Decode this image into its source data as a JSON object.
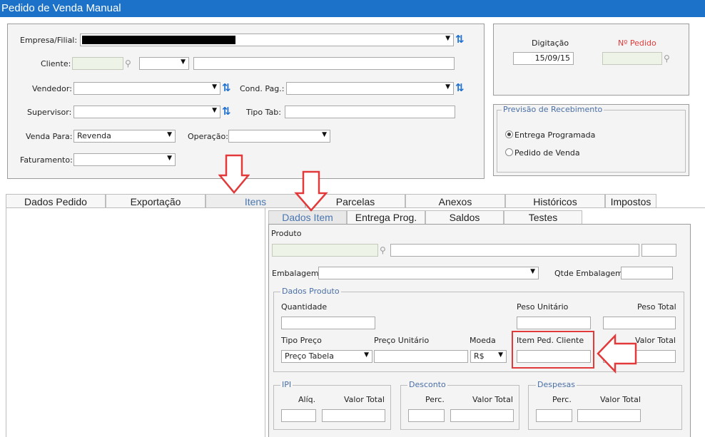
{
  "title": "Pedido de Venda Manual",
  "header": {
    "empresa_label": "Empresa/Filial:",
    "cliente_label": "Cliente:",
    "vendedor_label": "Vendedor:",
    "cond_pag_label": "Cond. Pag.:",
    "supervisor_label": "Supervisor:",
    "tipo_tab_label": "Tipo Tab:",
    "venda_para_label": "Venda Para:",
    "venda_para_value": "Revenda",
    "operacao_label": "Operação:",
    "faturamento_label": "Faturamento:"
  },
  "right_panel": {
    "digitacao_label": "Digitação",
    "digitacao_value": "15/09/15",
    "pedido_label": "Nº Pedido",
    "pedido_color": "#e23a3a"
  },
  "previsao": {
    "legend": "Previsão de Recebimento",
    "options": [
      {
        "label": "Entrega Programada",
        "selected": true
      },
      {
        "label": "Pedido de Venda",
        "selected": false
      }
    ]
  },
  "tabs": [
    "Dados Pedido",
    "Exportação",
    "Itens",
    "Parcelas",
    "Anexos",
    "Históricos",
    "Impostos"
  ],
  "active_tab": "Itens",
  "subtabs": [
    "Dados Item",
    "Entrega Prog.",
    "Saldos",
    "Testes"
  ],
  "active_subtab": "Dados Item",
  "item": {
    "produto_label": "Produto",
    "embalagem_label": "Embalagem",
    "qtde_embalagem_label": "Qtde Embalagem",
    "dados_produto_legend": "Dados Produto",
    "quantidade_label": "Quantidade",
    "peso_unitario_label": "Peso Unitário",
    "peso_total_label": "Peso Total",
    "tipo_preco_label": "Tipo Preço",
    "tipo_preco_value": "Preço Tabela",
    "preco_unitario_label": "Preço Unitário",
    "moeda_label": "Moeda",
    "moeda_value": "R$",
    "item_ped_cliente_label": "Item Ped. Cliente",
    "valor_total_label": "Valor Total"
  },
  "ipi": {
    "legend": "IPI",
    "aliq_label": "Alíq.",
    "valor_total_label": "Valor Total"
  },
  "desconto": {
    "legend": "Desconto",
    "perc_label": "Perc.",
    "valor_total_label": "Valor Total"
  },
  "despesas": {
    "legend": "Despesas",
    "perc_label": "Perc.",
    "valor_total_label": "Valor Total"
  },
  "colors": {
    "titlebar": "#1c72c8",
    "accent_tab": "#4a76b0",
    "highlight": "#e23a3a",
    "legend": "#4a6fa5"
  },
  "icons": [
    "refresh-icon",
    "magnifier-icon",
    "dropdown-arrow-icon",
    "down-arrow-annotation",
    "left-arrow-annotation"
  ]
}
